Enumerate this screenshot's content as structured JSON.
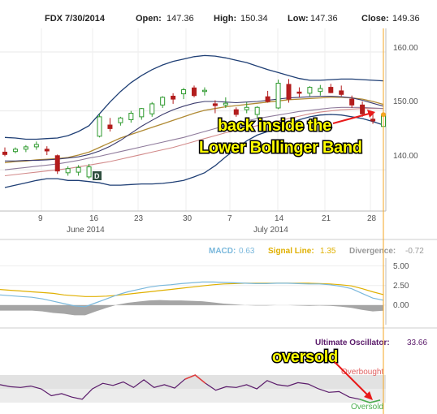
{
  "header": {
    "ticker_date": "FDX 7/30/2014",
    "open_label": "Open:",
    "open_value": "147.36",
    "high_label": "High:",
    "high_value": "150.34",
    "low_label": "Low:",
    "low_value": "147.36",
    "close_label": "Close:",
    "close_value": "149.36"
  },
  "chart_data": [
    {
      "type": "candlestick",
      "panel": "price",
      "yaxis_ticks": [
        "160.00",
        "150.00",
        "140.00"
      ],
      "ylim": [
        133,
        164
      ],
      "x_tick_labels": [
        "9",
        "16",
        "23",
        "30",
        "7",
        "14",
        "21",
        "28"
      ],
      "x_month_labels": [
        "June 2014",
        "July 2014"
      ],
      "candles": [
        {
          "o": 143.0,
          "h": 143.8,
          "l": 142.3,
          "c": 142.6
        },
        {
          "o": 143.1,
          "h": 143.8,
          "l": 142.8,
          "c": 143.5
        },
        {
          "o": 143.5,
          "h": 144.2,
          "l": 143.0,
          "c": 143.9
        },
        {
          "o": 143.9,
          "h": 144.8,
          "l": 143.4,
          "c": 144.3
        },
        {
          "o": 143.5,
          "h": 144.0,
          "l": 142.5,
          "c": 143.2
        },
        {
          "o": 142.4,
          "h": 142.6,
          "l": 139.3,
          "c": 139.8
        },
        {
          "o": 139.5,
          "h": 140.6,
          "l": 139.0,
          "c": 140.2
        },
        {
          "o": 139.6,
          "h": 140.8,
          "l": 139.0,
          "c": 140.4
        },
        {
          "o": 138.8,
          "h": 141.0,
          "l": 138.5,
          "c": 140.5
        },
        {
          "o": 145.7,
          "h": 149.5,
          "l": 145.5,
          "c": 149.0
        },
        {
          "o": 147.6,
          "h": 148.8,
          "l": 146.5,
          "c": 147.0
        },
        {
          "o": 148.0,
          "h": 149.0,
          "l": 147.5,
          "c": 148.8
        },
        {
          "o": 148.5,
          "h": 150.0,
          "l": 148.0,
          "c": 149.6
        },
        {
          "o": 149.0,
          "h": 150.5,
          "l": 148.5,
          "c": 150.4
        },
        {
          "o": 149.5,
          "h": 151.5,
          "l": 149.0,
          "c": 151.2
        },
        {
          "o": 151.0,
          "h": 152.5,
          "l": 150.5,
          "c": 152.3
        },
        {
          "o": 152.5,
          "h": 153.0,
          "l": 151.2,
          "c": 152.0
        },
        {
          "o": 152.9,
          "h": 153.9,
          "l": 152.0,
          "c": 153.6
        },
        {
          "o": 153.9,
          "h": 154.3,
          "l": 152.3,
          "c": 152.6
        },
        {
          "o": 153.5,
          "h": 154.0,
          "l": 152.6,
          "c": 153.5
        },
        {
          "o": 151.2,
          "h": 151.8,
          "l": 149.6,
          "c": 150.9
        },
        {
          "o": 151.0,
          "h": 152.3,
          "l": 150.5,
          "c": 151.3
        },
        {
          "o": 150.2,
          "h": 150.6,
          "l": 149.0,
          "c": 149.4
        },
        {
          "o": 150.2,
          "h": 151.5,
          "l": 149.6,
          "c": 150.6
        },
        {
          "o": 149.4,
          "h": 150.8,
          "l": 148.7,
          "c": 150.6
        },
        {
          "o": 152.4,
          "h": 153.4,
          "l": 151.4,
          "c": 151.6
        },
        {
          "o": 150.5,
          "h": 155.3,
          "l": 150.3,
          "c": 154.7
        },
        {
          "o": 154.5,
          "h": 155.4,
          "l": 151.4,
          "c": 152.0
        },
        {
          "o": 153.2,
          "h": 154.0,
          "l": 152.3,
          "c": 153.0
        },
        {
          "o": 153.0,
          "h": 154.2,
          "l": 152.5,
          "c": 154.0
        },
        {
          "o": 153.3,
          "h": 154.4,
          "l": 152.6,
          "c": 153.8
        },
        {
          "o": 154.0,
          "h": 154.6,
          "l": 153.0,
          "c": 153.1
        },
        {
          "o": 153.4,
          "h": 154.3,
          "l": 152.5,
          "c": 152.8
        },
        {
          "o": 152.0,
          "h": 152.6,
          "l": 150.5,
          "c": 151.0
        },
        {
          "o": 151.0,
          "h": 151.6,
          "l": 149.0,
          "c": 149.5
        },
        {
          "o": 148.6,
          "h": 149.6,
          "l": 147.8,
          "c": 148.3
        },
        {
          "o": 147.36,
          "h": 150.34,
          "l": 147.36,
          "c": 149.36
        }
      ],
      "bollinger_upper": [
        145.5,
        145.4,
        145.2,
        145.2,
        145.3,
        145.4,
        145.8,
        146.5,
        147.5,
        149.5,
        151.5,
        153.3,
        154.8,
        156.0,
        157.0,
        157.8,
        158.4,
        158.8,
        159.2,
        159.4,
        159.3,
        159.0,
        158.6,
        158.2,
        157.6,
        157.0,
        156.5,
        156.0,
        155.5,
        155.2,
        155.2,
        155.3,
        155.4,
        155.4,
        155.3,
        155.2,
        155.1
      ],
      "bollinger_middle": [
        141.2,
        141.4,
        141.5,
        141.7,
        141.8,
        141.9,
        142.1,
        142.5,
        143.0,
        143.8,
        144.6,
        145.4,
        146.0,
        146.6,
        147.2,
        147.8,
        148.4,
        149.0,
        149.6,
        150.1,
        150.4,
        150.7,
        150.9,
        151.1,
        151.3,
        151.5,
        151.7,
        151.9,
        152.0,
        152.1,
        152.2,
        152.3,
        152.3,
        152.2,
        152.0,
        151.6,
        151.1
      ],
      "bollinger_lower": [
        137.0,
        137.4,
        137.8,
        138.2,
        138.5,
        138.5,
        138.2,
        138.2,
        138.0,
        137.8,
        137.4,
        137.4,
        137.5,
        137.6,
        137.6,
        137.7,
        137.9,
        138.2,
        138.8,
        139.5,
        140.7,
        142.2,
        143.6,
        144.9,
        145.9,
        146.5,
        147.2,
        147.8,
        148.5,
        149.0,
        149.3,
        149.4,
        149.3,
        149.0,
        148.7,
        148.2,
        147.6
      ],
      "sma_a": [
        139.0,
        139.2,
        139.4,
        139.6,
        139.8,
        140.0,
        140.2,
        140.5,
        140.8,
        141.1,
        141.4,
        141.8,
        142.2,
        142.6,
        143.0,
        143.4,
        143.8,
        144.3,
        144.8,
        145.3,
        145.8,
        146.3,
        146.7,
        147.1,
        147.5,
        147.9,
        148.3,
        148.7,
        149.1,
        149.5,
        149.8,
        150.0,
        150.2,
        150.3,
        150.4,
        150.4,
        150.4
      ],
      "sma_b": [
        140.0,
        140.2,
        140.4,
        140.6,
        140.8,
        141.0,
        141.3,
        141.6,
        142.0,
        142.3,
        142.7,
        143.1,
        143.5,
        143.9,
        144.3,
        144.7,
        145.1,
        145.5,
        146.0,
        146.5,
        147.0,
        147.5,
        147.9,
        148.3,
        148.7,
        149.0,
        149.3,
        149.6,
        149.9,
        150.1,
        150.3,
        150.5,
        150.6,
        150.6,
        150.6,
        150.5,
        150.4
      ],
      "sma_c": [
        141.5,
        141.5,
        141.6,
        141.6,
        141.7,
        141.8,
        142.0,
        142.2,
        142.6,
        143.2,
        144.0,
        145.0,
        146.2,
        147.4,
        148.4,
        149.4,
        150.2,
        150.8,
        151.3,
        151.6,
        151.6,
        151.5,
        151.4,
        151.5,
        151.6,
        151.8,
        152.0,
        152.2,
        152.3,
        152.4,
        152.5,
        152.5,
        152.4,
        152.2,
        151.8,
        151.3,
        150.8
      ],
      "marker_label": "D",
      "annotation_lines": [
        "back inside the",
        "Lower Bollinger Band"
      ]
    },
    {
      "type": "line",
      "panel": "macd",
      "macd_label": "MACD:",
      "macd_value": "0.63",
      "signal_label": "Signal Line:",
      "signal_value": "1.35",
      "divergence_label": "Divergence:",
      "divergence_value": "-0.72",
      "yaxis_ticks": [
        "5.00",
        "2.50",
        "0.00"
      ],
      "ylim": [
        -2.5,
        6.0
      ],
      "macd": [
        1.3,
        1.2,
        1.1,
        1.0,
        0.8,
        0.5,
        0.2,
        -0.1,
        -0.2,
        0.3,
        0.8,
        1.3,
        1.7,
        2.0,
        2.3,
        2.5,
        2.6,
        2.75,
        2.85,
        2.95,
        2.95,
        2.9,
        2.85,
        2.8,
        2.75,
        2.75,
        2.8,
        2.8,
        2.75,
        2.7,
        2.7,
        2.6,
        2.4,
        2.1,
        1.5,
        0.9,
        0.63
      ],
      "signal": [
        2.0,
        1.9,
        1.8,
        1.7,
        1.6,
        1.5,
        1.3,
        1.2,
        1.1,
        1.1,
        1.15,
        1.25,
        1.4,
        1.55,
        1.7,
        1.85,
        2.0,
        2.15,
        2.3,
        2.45,
        2.6,
        2.7,
        2.75,
        2.8,
        2.8,
        2.8,
        2.8,
        2.8,
        2.8,
        2.8,
        2.75,
        2.7,
        2.6,
        2.45,
        2.1,
        1.7,
        1.35
      ],
      "divergence": [
        -0.7,
        -0.7,
        -0.7,
        -0.7,
        -0.8,
        -1.0,
        -1.1,
        -1.3,
        -1.3,
        -0.8,
        -0.35,
        0.05,
        0.3,
        0.45,
        0.6,
        0.65,
        0.6,
        0.6,
        0.55,
        0.5,
        0.35,
        0.2,
        0.1,
        0.0,
        -0.05,
        -0.05,
        0.0,
        0.0,
        -0.05,
        -0.1,
        -0.05,
        -0.1,
        -0.2,
        -0.35,
        -0.6,
        -0.8,
        -0.72
      ]
    },
    {
      "type": "line",
      "panel": "ultimate_oscillator",
      "title": "Ultimate Oscillator:",
      "value": "33.66",
      "overbought_label": "Overbought",
      "oversold_label": "Oversold",
      "annotation": "oversold",
      "values": [
        56,
        53,
        52,
        54,
        50,
        40,
        43,
        38,
        35,
        50,
        58,
        55,
        60,
        52,
        63,
        52,
        56,
        51,
        64,
        70,
        58,
        48,
        53,
        52,
        56,
        50,
        62,
        56,
        54,
        59,
        57,
        50,
        45,
        46,
        38,
        35,
        30,
        33.66
      ]
    }
  ],
  "colors": {
    "candle_up": "#2e9a2e",
    "candle_down": "#b31d1d",
    "bollinger": "#1f3f75",
    "middle_band": "#b08a33",
    "sma_a": "#d28a8a",
    "sma_b": "#8e7a9b",
    "sma_c": "#3c3c6e",
    "macd": "#7ab8dc",
    "signal": "#e0b000",
    "histogram": "#8e8e8e",
    "ultimate": "#5a1a6a",
    "cursor": "#f5a623",
    "annotation_arrow": "#e81a1a"
  }
}
